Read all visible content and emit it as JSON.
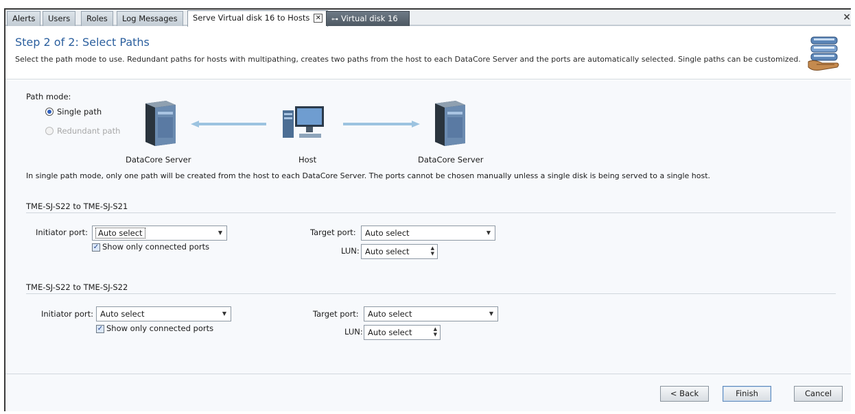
{
  "tabs": [
    {
      "label": "Alerts"
    },
    {
      "label": "Users"
    },
    {
      "label": "Roles"
    },
    {
      "label": "Log Messages"
    },
    {
      "label": "Serve Virtual disk 16 to Hosts",
      "active": true,
      "close": "✕"
    },
    {
      "label": "Virtual disk 16",
      "pinned": true
    }
  ],
  "window_close": "×",
  "header": {
    "title": "Step 2 of 2: Select Paths",
    "description": "Select the path mode to use. Redundant paths for hosts with multipathing, creates two paths from the host to each DataCore Server and the ports are automatically selected. Single paths can be customized."
  },
  "path_mode": {
    "label": "Path mode:",
    "options": [
      {
        "label": "Single path",
        "selected": true,
        "enabled": true
      },
      {
        "label": "Redundant path",
        "selected": false,
        "enabled": false
      }
    ]
  },
  "diagram": {
    "left_server": "DataCore Server",
    "host": "Host",
    "right_server": "DataCore Server"
  },
  "info_text": "In single path mode, only one path will be created from the host to each DataCore Server. The ports cannot be chosen manually unless a single disk is being served to a single host.",
  "sections": [
    {
      "title": "TME-SJ-S22 to TME-SJ-S21",
      "initiator_label": "Initiator port:",
      "initiator_value": "Auto select",
      "show_connected": "Show only connected ports",
      "target_label": "Target port:",
      "target_value": "Auto select",
      "lun_label": "LUN:",
      "lun_value": "Auto select"
    },
    {
      "title": "TME-SJ-S22 to TME-SJ-S22",
      "initiator_label": "Initiator port:",
      "initiator_value": "Auto select",
      "show_connected": "Show only connected ports",
      "target_label": "Target port:",
      "target_value": "Auto select",
      "lun_label": "LUN:",
      "lun_value": "Auto select"
    }
  ],
  "buttons": {
    "back": "< Back",
    "finish": "Finish",
    "cancel": "Cancel"
  },
  "colors": {
    "title": "#2b5f9e",
    "arrow": "#9cc3e0",
    "content_bg": "#f7f9fc"
  }
}
